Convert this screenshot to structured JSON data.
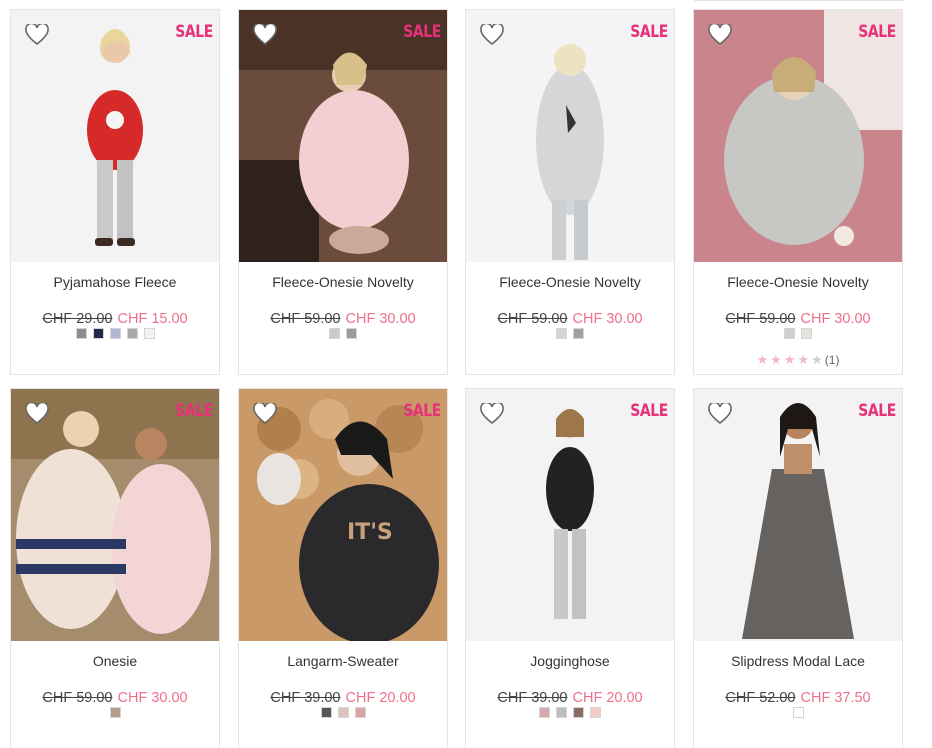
{
  "products": [
    {
      "name": "Pyjamahose Fleece",
      "old_price": "CHF 29.00",
      "new_price": "CHF 15.00",
      "sale": "SALE",
      "swatches": [
        "#8e8e8e",
        "#1f2a4a",
        "#b3b6d3",
        "#a8a8a8",
        "#f4f1ef"
      ],
      "scene": "red"
    },
    {
      "name": "Fleece-Onesie Novelty",
      "old_price": "CHF 59.00",
      "new_price": "CHF 30.00",
      "sale": "SALE",
      "swatches": [
        "#c9c9c9",
        "#9a9a9a"
      ],
      "scene": "pink"
    },
    {
      "name": "Fleece-Onesie Novelty",
      "old_price": "CHF 59.00",
      "new_price": "CHF 30.00",
      "sale": "SALE",
      "swatches": [
        "#d6d4d2",
        "#a0a0a0"
      ],
      "scene": "grey"
    },
    {
      "name": "Fleece-Onesie Novelty",
      "old_price": "CHF 59.00",
      "new_price": "CHF 30.00",
      "sale": "SALE",
      "swatches": [
        "#cfcfcf",
        "#e6e3df"
      ],
      "scene": "leopard",
      "rating": {
        "stars": 4,
        "count": "(1)"
      }
    },
    {
      "name": "Onesie",
      "old_price": "CHF 59.00",
      "new_price": "CHF 30.00",
      "sale": "SALE",
      "swatches": [
        "#b59b8a"
      ],
      "scene": "nordic"
    },
    {
      "name": "Langarm-Sweater",
      "old_price": "CHF 39.00",
      "new_price": "CHF 20.00",
      "sale": "SALE",
      "swatches": [
        "#555555",
        "#dcc3c0",
        "#d9a3a8"
      ],
      "scene": "sweater"
    },
    {
      "name": "Jogginghose",
      "old_price": "CHF 39.00",
      "new_price": "CHF 20.00",
      "sale": "SALE",
      "swatches": [
        "#d6a9aa",
        "#bdbdbd",
        "#8b6a66",
        "#f4cccb"
      ],
      "scene": "jogging"
    },
    {
      "name": "Slipdress Modal Lace",
      "old_price": "CHF 52.00",
      "new_price": "CHF 37.50",
      "sale": "SALE",
      "swatches": [
        "#ffffff"
      ],
      "scene": "lace"
    }
  ]
}
